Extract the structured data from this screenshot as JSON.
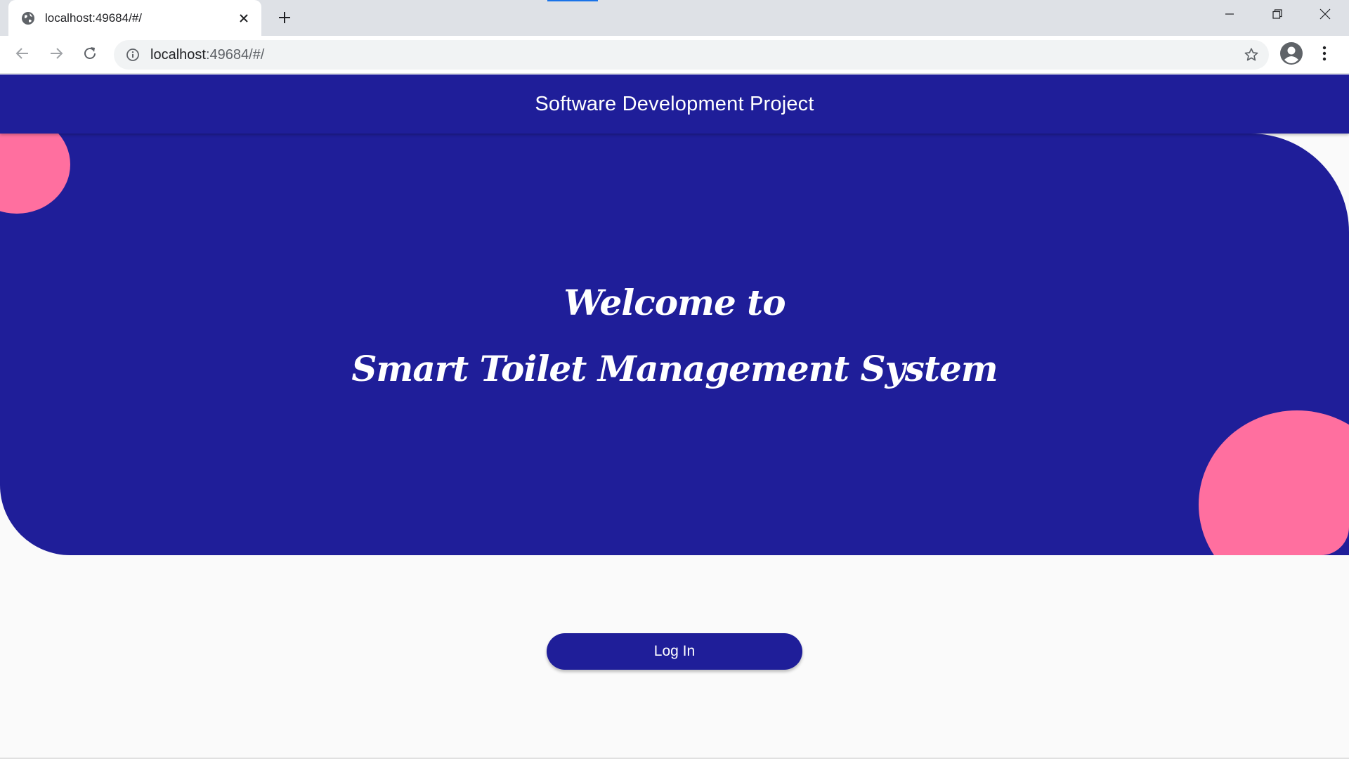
{
  "browser": {
    "tab": {
      "title": "localhost:49684/#/",
      "favicon": "globe-icon"
    },
    "omnibox": {
      "url_host": "localhost",
      "url_rest": ":49684/#/"
    },
    "icons": {
      "back": "arrow-left-icon",
      "forward": "arrow-right-icon",
      "reload": "reload-icon",
      "info": "info-icon",
      "bookmark": "star-icon",
      "profile": "account-circle-icon",
      "menu": "more-vert-icon",
      "new_tab": "plus-icon",
      "minimize": "minimize-icon",
      "restore": "restore-icon",
      "close": "close-icon"
    }
  },
  "app": {
    "appbar_title": "Software Development Project",
    "hero": {
      "line1": "Welcome to",
      "line2": "Smart Toilet Management System"
    },
    "login_button": "Log In"
  },
  "colors": {
    "primary": "#1f1e99",
    "accent": "#ff6f9f",
    "background": "#fafafa",
    "text_on_primary": "#ffffff"
  }
}
